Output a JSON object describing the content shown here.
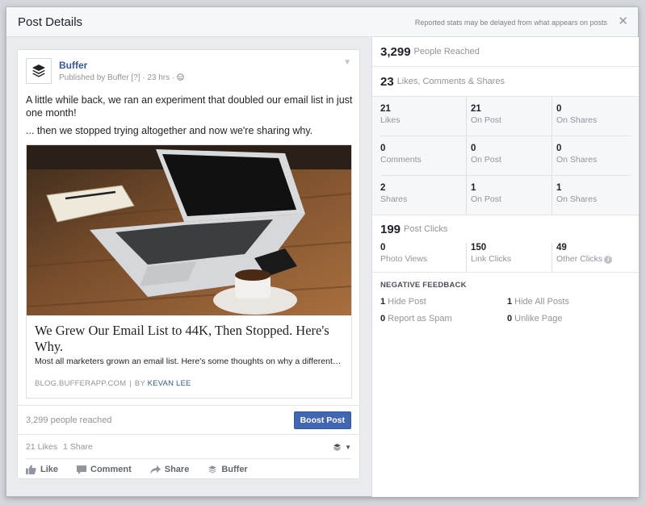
{
  "modal": {
    "title": "Post Details",
    "header_note": "Reported stats may be delayed from what appears on posts",
    "close_glyph": "✕"
  },
  "post": {
    "page_name": "Buffer",
    "meta": "Published by Buffer [?] · 23 hrs ·",
    "text_lines": [
      "A little while back, we ran an experiment that doubled our email list in just one month!",
      "... then we stopped trying altogether and now we're sharing why."
    ],
    "link": {
      "title": "We Grew Our Email List to 44K, Then Stopped. Here's Why.",
      "description": "Most all marketers grown an email list. Here's some thoughts on why a different…",
      "domain": "BLOG.BUFFERAPP.COM",
      "by_label": "BY",
      "author": "KEVAN LEE"
    },
    "reach_text": "3,299 people reached",
    "boost_label": "Boost Post",
    "likes_text": "21 Likes",
    "shares_text": "1 Share",
    "actions": [
      "Like",
      "Comment",
      "Share",
      "Buffer"
    ]
  },
  "stats": {
    "reached": {
      "value": "3,299",
      "label": "People Reached"
    },
    "engagement": {
      "value": "23",
      "label": "Likes, Comments & Shares"
    },
    "grid": [
      [
        {
          "v": "21",
          "l": "Likes"
        },
        {
          "v": "21",
          "l": "On Post"
        },
        {
          "v": "0",
          "l": "On Shares"
        }
      ],
      [
        {
          "v": "0",
          "l": "Comments"
        },
        {
          "v": "0",
          "l": "On Post"
        },
        {
          "v": "0",
          "l": "On Shares"
        }
      ],
      [
        {
          "v": "2",
          "l": "Shares"
        },
        {
          "v": "1",
          "l": "On Post"
        },
        {
          "v": "1",
          "l": "On Shares"
        }
      ]
    ],
    "clicks": {
      "value": "199",
      "label": "Post Clicks",
      "items": [
        {
          "v": "0",
          "l": "Photo Views"
        },
        {
          "v": "150",
          "l": "Link Clicks"
        },
        {
          "v": "49",
          "l": "Other Clicks"
        }
      ]
    },
    "negative": {
      "title": "NEGATIVE FEEDBACK",
      "items": [
        {
          "v": "1",
          "l": "Hide Post"
        },
        {
          "v": "1",
          "l": "Hide All Posts"
        },
        {
          "v": "0",
          "l": "Report as Spam"
        },
        {
          "v": "0",
          "l": "Unlike Page"
        }
      ]
    }
  },
  "colors": {
    "brand_blue": "#4267b2",
    "link_blue": "#365899",
    "muted": "#90949c"
  }
}
